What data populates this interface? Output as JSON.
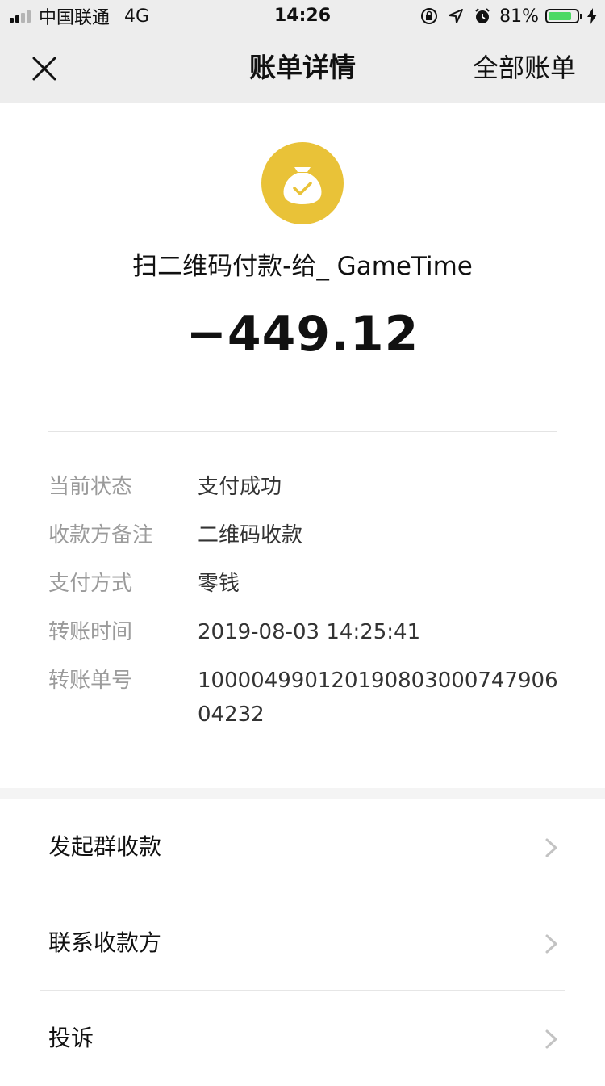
{
  "status_bar": {
    "carrier": "中国联通",
    "network": "4G",
    "time": "14:26",
    "battery_percent": "81%",
    "battery_level": 0.81,
    "icons": [
      "signal-icon",
      "orientation-lock-icon",
      "location-icon",
      "alarm-icon",
      "battery-icon",
      "charging-icon"
    ]
  },
  "nav": {
    "close_icon": "close-icon",
    "title": "账单详情",
    "right_label": "全部账单"
  },
  "summary": {
    "icon": "money-bag-check-icon",
    "icon_color": "#e9c238",
    "title": "扫二维码付款-给_ GameTime",
    "amount": "−449.12"
  },
  "details": [
    {
      "label": "当前状态",
      "value": "支付成功"
    },
    {
      "label": "收款方备注",
      "value": "二维码收款"
    },
    {
      "label": "支付方式",
      "value": "零钱"
    },
    {
      "label": "转账时间",
      "value": "2019-08-03 14:25:41"
    },
    {
      "label": "转账单号",
      "value": "100004990120190803000747906​04232"
    }
  ],
  "actions": [
    {
      "label": "发起群收款",
      "icon": "chevron-right-icon"
    },
    {
      "label": "联系收款方",
      "icon": "chevron-right-icon"
    },
    {
      "label": "投诉",
      "icon": "chevron-right-icon"
    }
  ]
}
